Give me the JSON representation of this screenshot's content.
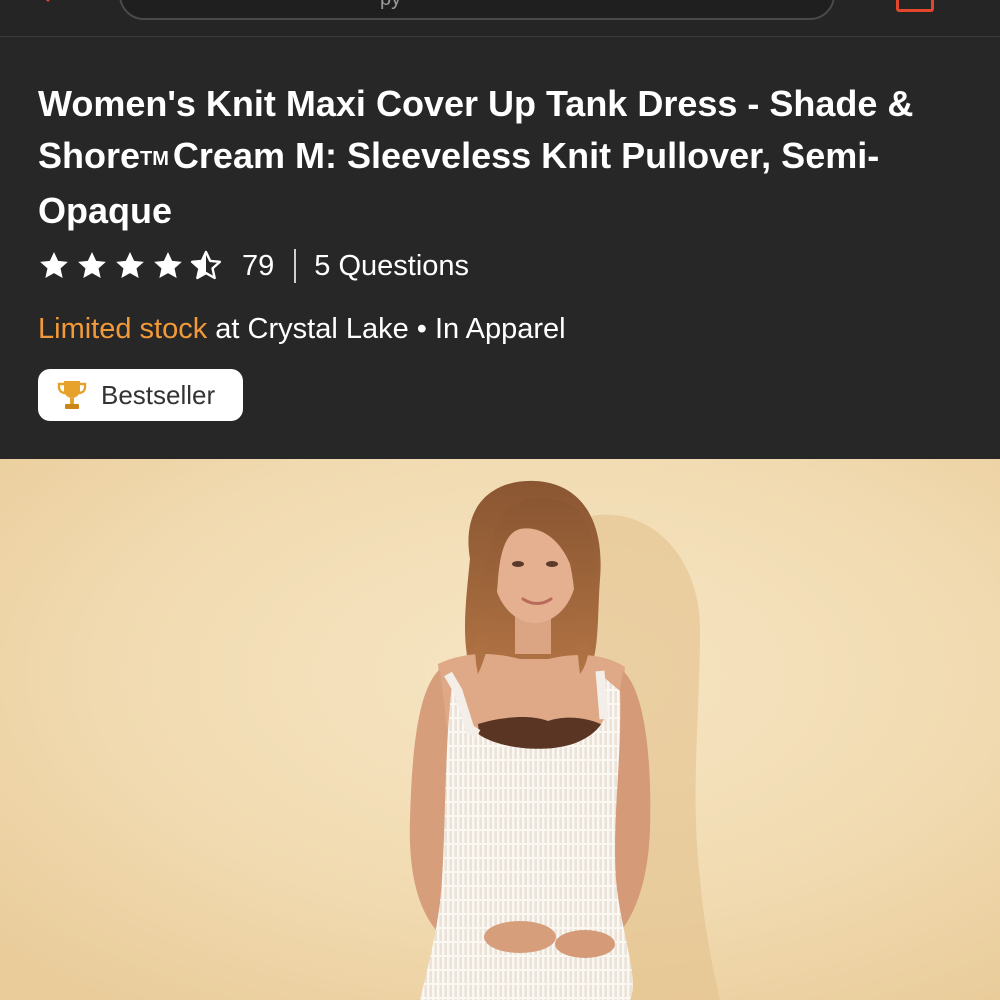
{
  "header": {
    "search_visible_text": "py"
  },
  "product": {
    "title_part1": "Women's Knit Maxi Cover Up Tank Dress - Shade & Shore",
    "trademark": "TM",
    "title_part2": "Cream M: Sleeveless Knit Pullover, Semi-Opaque",
    "rating": 4.5,
    "rating_max": 5,
    "review_count": "79",
    "questions_label": "5 Questions",
    "stock_status": "Limited stock",
    "stock_location": "at Crystal Lake • In Apparel",
    "badge_label": "Bestseller"
  },
  "colors": {
    "background": "#272727",
    "accent_red": "#e2472b",
    "stock_orange": "#f29a3a",
    "trophy_gold": "#e7a22b",
    "image_backdrop": "#f3dfb8"
  },
  "icons": {
    "back": "back-arrow-icon",
    "cart": "cart-icon",
    "star_full": "star-filled-icon",
    "star_half": "star-half-icon",
    "trophy": "trophy-icon"
  }
}
